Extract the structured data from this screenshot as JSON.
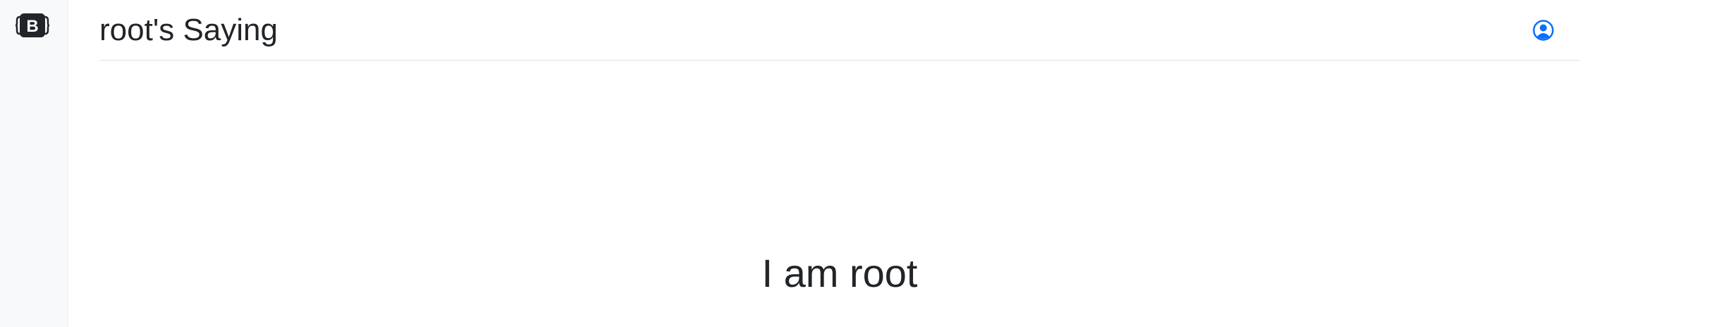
{
  "brand": {
    "icon": "bootstrap-logo-icon",
    "letter": "B"
  },
  "header": {
    "title": "root's Saying",
    "profile_icon": "person-circle-icon",
    "accent": "#0d6efd"
  },
  "content": {
    "saying": "I am root"
  }
}
